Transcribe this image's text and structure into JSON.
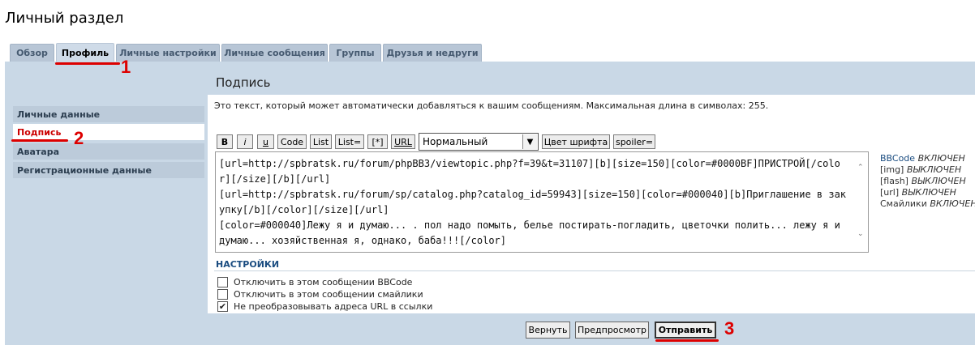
{
  "page": {
    "title": "Личный раздел"
  },
  "tabs": [
    {
      "label": "Обзор"
    },
    {
      "label": "Профиль"
    },
    {
      "label": "Личные настройки"
    },
    {
      "label": "Личные сообщения"
    },
    {
      "label": "Группы"
    },
    {
      "label": "Друзья и недруги"
    }
  ],
  "sidebar": {
    "items": [
      {
        "label": "Личные данные"
      },
      {
        "label": "Подпись"
      },
      {
        "label": "Аватара"
      },
      {
        "label": "Регистрационные данные"
      }
    ]
  },
  "signature": {
    "heading": "Подпись",
    "description": "Это текст, который может автоматически добавляться к вашим сообщениям. Максимальная длина в символах: 255.",
    "text": "[url=http://spbratsk.ru/forum/phpBB3/viewtopic.php?f=39&t=31107][b][size=150][color=#0000BF]ПРИСТРОЙ[/color][/size][/b][/url]\n[url=http://spbratsk.ru/forum/sp/catalog.php?catalog_id=59943][size=150][color=#000040][b]Приглашение в закупку[/b][/color][/size][/url]\n[color=#000040]Лежу я и думаю... . пол надо помыть, белье постирать-погладить, цветочки полить... лежу я и думаю... хозяйственная я, однако, баба!!![/color]"
  },
  "toolbar": {
    "bold": "B",
    "italic": "i",
    "underline": "u",
    "code": "Code",
    "list": "List",
    "list_eq": "List=",
    "list_item": "[*]",
    "url": "URL",
    "font_size": "Нормальный",
    "font_color": "Цвет шрифта",
    "spoiler": "spoiler="
  },
  "bbcode_status": [
    {
      "label": "BBCode",
      "state": "ВКЛЮЧЕН"
    },
    {
      "label": "[img]",
      "state": "ВЫКЛЮЧЕН"
    },
    {
      "label": "[flash]",
      "state": "ВЫКЛЮЧЕН"
    },
    {
      "label": "[url]",
      "state": "ВЫКЛЮЧЕН"
    },
    {
      "label": "Смайлики",
      "state": "ВКЛЮЧЕН"
    }
  ],
  "settings": {
    "title": "НАСТРОЙКИ",
    "options": [
      {
        "label": "Отключить в этом сообщении BBCode",
        "checked": false
      },
      {
        "label": "Отключить в этом сообщении смайлики",
        "checked": false
      },
      {
        "label": "Не преобразовывать адреса URL в ссылки",
        "checked": true
      }
    ]
  },
  "actions": {
    "reset": "Вернуть",
    "preview": "Предпросмотр",
    "submit": "Отправить"
  },
  "annotations": [
    "1",
    "2",
    "3"
  ],
  "colors": {
    "panel": "#c9d8e6",
    "tab": "#b8c6d6",
    "accent_red": "#dd0000",
    "link": "#1a4c80"
  }
}
